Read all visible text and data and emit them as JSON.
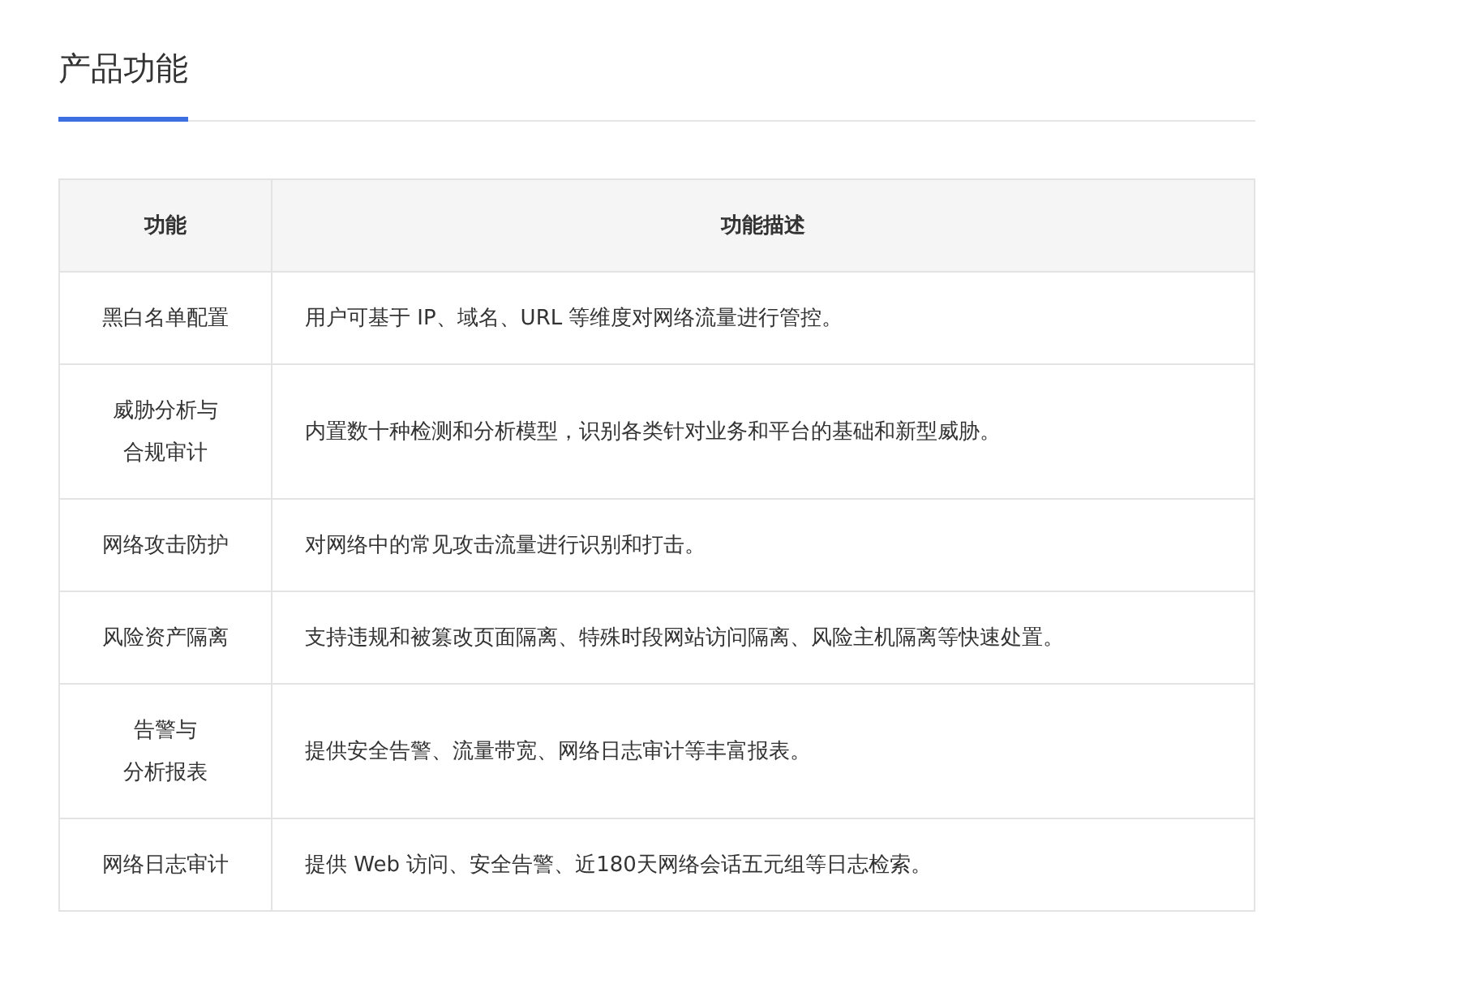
{
  "section_title": "产品功能",
  "table": {
    "columns": [
      "功能",
      "功能描述"
    ],
    "rows": [
      {
        "feature": [
          "黑白名单配置"
        ],
        "description": "用户可基于 IP、域名、URL 等维度对网络流量进行管控。"
      },
      {
        "feature": [
          "威胁分析与",
          "合规审计"
        ],
        "description": "内置数十种检测和分析模型，识别各类针对业务和平台的基础和新型威胁。"
      },
      {
        "feature": [
          "网络攻击防护"
        ],
        "description": "对网络中的常见攻击流量进行识别和打击。"
      },
      {
        "feature": [
          "风险资产隔离"
        ],
        "description": "支持违规和被篡改页面隔离、特殊时段网站访问隔离、风险主机隔离等快速处置。"
      },
      {
        "feature": [
          "告警与",
          "分析报表"
        ],
        "description": "提供安全告警、流量带宽、网络日志审计等丰富报表。"
      },
      {
        "feature": [
          "网络日志审计"
        ],
        "description": "提供 Web 访问、安全告警、近180天网络会话五元组等日志检索。"
      }
    ]
  }
}
